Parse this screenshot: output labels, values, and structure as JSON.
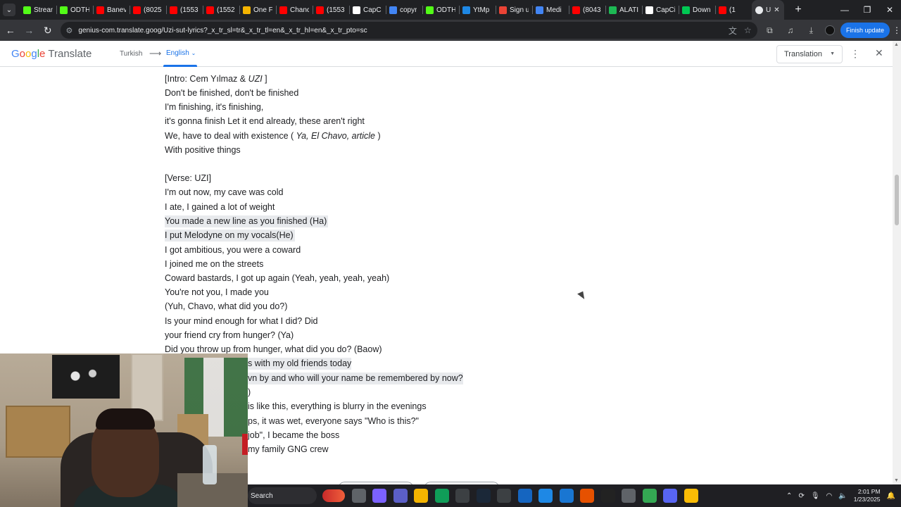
{
  "tabs": [
    {
      "label": "Strean",
      "icon": "kick-icon",
      "color": "#53fc18"
    },
    {
      "label": "ODTH",
      "icon": "kick-icon",
      "color": "#53fc18"
    },
    {
      "label": "Banev",
      "icon": "youtube-icon",
      "color": "#ff0000"
    },
    {
      "label": "(8025",
      "icon": "youtube-icon",
      "color": "#ff0000"
    },
    {
      "label": "(1553",
      "icon": "youtube-icon",
      "color": "#ff0000"
    },
    {
      "label": "(1552",
      "icon": "youtube-icon",
      "color": "#ff0000"
    },
    {
      "label": "One F",
      "icon": "doc-icon",
      "color": "#f4b400"
    },
    {
      "label": "Chanc",
      "icon": "youtube-icon",
      "color": "#ff0000"
    },
    {
      "label": "(1553",
      "icon": "youtube-icon",
      "color": "#ff0000"
    },
    {
      "label": "CapC",
      "icon": "capcut-icon",
      "color": "#ffffff"
    },
    {
      "label": "copyr",
      "icon": "docs-icon",
      "color": "#4285f4"
    },
    {
      "label": "ODTH",
      "icon": "kick-icon",
      "color": "#53fc18"
    },
    {
      "label": "YtMp",
      "icon": "ytmp-icon",
      "color": "#1e88e5"
    },
    {
      "label": "Sign u",
      "icon": "gmail-icon",
      "color": "#ea4335"
    },
    {
      "label": "Medi",
      "icon": "media-icon",
      "color": "#4285f4"
    },
    {
      "label": "(8043",
      "icon": "youtube-icon",
      "color": "#ff0000"
    },
    {
      "label": "ALATI",
      "icon": "spotify-icon",
      "color": "#1db954"
    },
    {
      "label": "CapCi",
      "icon": "capcut-icon",
      "color": "#ffffff"
    },
    {
      "label": "Down",
      "icon": "download-icon",
      "color": "#00c853"
    },
    {
      "label": "(1",
      "icon": "youtube-icon",
      "color": "#ff0000"
    }
  ],
  "active_tab": {
    "label": "U",
    "close": "✕"
  },
  "new_tab": "+",
  "window": {
    "minimize": "—",
    "maximize": "❐",
    "close": "✕"
  },
  "toolbar": {
    "url": "genius-com.translate.goog/Uzi-sut-lyrics?_x_tr_sl=tr&_x_tr_tl=en&_x_tr_hl=en&_x_tr_pto=sc",
    "finish_update": "Finish update"
  },
  "translate": {
    "logo_google": "Google",
    "logo_product": "Translate",
    "source_lang": "Turkish",
    "arrow": "⟶",
    "target_lang": "English",
    "mode": "Translation"
  },
  "lyrics": [
    {
      "text": "[Intro: Cem Yılmaz & ",
      "italic": "UZI",
      "suffix": " ]"
    },
    {
      "text": "Don't be finished, don't be finished"
    },
    {
      "text": "I'm finishing, it's finishing,"
    },
    {
      "text": "it's gonna finish Let it end already, these aren't right"
    },
    {
      "text": "We, have to deal with existence ( ",
      "italic": "Ya, El Chavo, article",
      "suffix": " )"
    },
    {
      "text": "With positive things"
    },
    {
      "text": "[Verse: UZI]"
    },
    {
      "text": "I'm out now, my cave was cold"
    },
    {
      "text": "I ate, I gained a lot of weight"
    },
    {
      "text": "You made a new line as you finished (Ha)"
    },
    {
      "text": "I put Melodyne on my vocals(He)"
    },
    {
      "text": "I got ambitious, you were a coward"
    },
    {
      "text": "I joined me on the streets"
    },
    {
      "text": "Coward bastards, I got up again (Yeah, yeah, yeah, yeah)"
    },
    {
      "text": "You're not you, I made you"
    },
    {
      "text": "(Yuh, Chavo, what did you do?)"
    },
    {
      "text": "Is your mind enough for what I did? Did"
    },
    {
      "text": "your friend cry from hunger? (Ya)"
    },
    {
      "text": "Did you throw up from hunger, what did you do? (Baow)"
    },
    {
      "text": "s with my old friends today"
    },
    {
      "text": "vn by and who will your name be remembered by now?"
    },
    {
      "text": ")"
    },
    {
      "text": "is like this, everything is blurry in the evenings"
    },
    {
      "text": "ps, it was wet, everyone says \"Who is this?\""
    },
    {
      "text": " job\", I became the boss"
    },
    {
      "text": "my family GNG crew"
    }
  ],
  "taskbar": {
    "search": "Search",
    "apps": [
      {
        "name": "task-view-icon",
        "color": "#5f6368"
      },
      {
        "name": "copilot-icon",
        "color": "#7b61ff"
      },
      {
        "name": "teams-icon",
        "color": "#5b5fc7"
      },
      {
        "name": "file-explorer-icon",
        "color": "#f4b400"
      },
      {
        "name": "edge-icon",
        "color": "#0f9d58"
      },
      {
        "name": "store-icon",
        "color": "#3c4043"
      },
      {
        "name": "steam-icon",
        "color": "#1b2838"
      },
      {
        "name": "chatgpt-icon",
        "color": "#3c4043"
      },
      {
        "name": "calculator-icon",
        "color": "#1565c0"
      },
      {
        "name": "notepad-icon",
        "color": "#1e88e5"
      },
      {
        "name": "photos-icon",
        "color": "#1976d2"
      },
      {
        "name": "app-orange-icon",
        "color": "#e65100"
      },
      {
        "name": "epic-games-icon",
        "color": "#222222"
      },
      {
        "name": "settings-icon",
        "color": "#5f6368"
      },
      {
        "name": "chrome-icon",
        "color": "#34a853"
      },
      {
        "name": "discord-icon",
        "color": "#5865f2"
      },
      {
        "name": "chrome-alt-icon",
        "color": "#fbbc05"
      }
    ],
    "time": "2:01 PM",
    "date": "1/23/2025"
  }
}
